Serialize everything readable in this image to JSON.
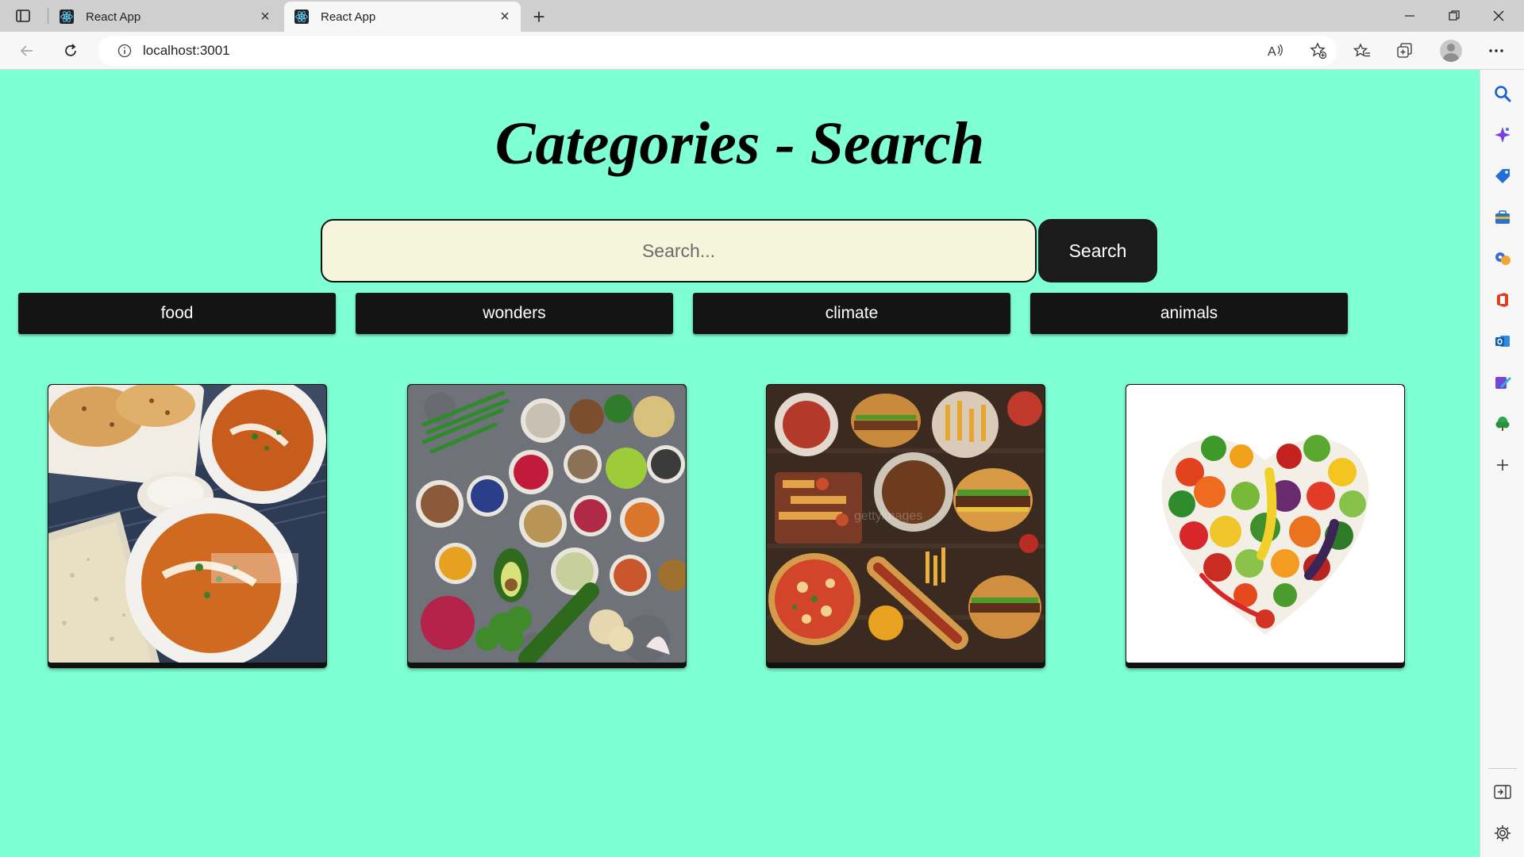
{
  "browser": {
    "tabs": [
      {
        "title": "React App",
        "active": false
      },
      {
        "title": "React App",
        "active": true
      }
    ],
    "url": "localhost:3001"
  },
  "page": {
    "title": "Categories - Search",
    "search": {
      "placeholder": "Search...",
      "value": "",
      "button_label": "Search"
    },
    "categories": [
      "food",
      "wonders",
      "climate",
      "animals"
    ],
    "images": [
      {
        "icon": "indian-curry-photo"
      },
      {
        "icon": "healthy-food-bowls-photo"
      },
      {
        "icon": "fast-food-table-photo"
      },
      {
        "icon": "vegetable-heart-photo"
      }
    ]
  },
  "colors": {
    "page_background": "#7fffd4",
    "search_background": "#f5f5dc",
    "button_background": "#141414",
    "button_text": "#ffffff"
  }
}
